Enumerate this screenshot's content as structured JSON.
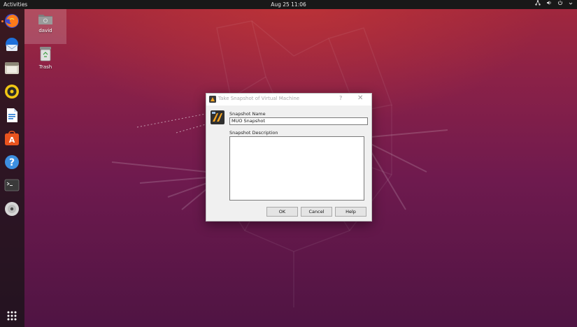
{
  "topbar": {
    "activities_label": "Activities",
    "clock": "Aug 25  11:06"
  },
  "desktop": {
    "icons": [
      {
        "label": "david",
        "icon": "home-folder-icon"
      },
      {
        "label": "Trash",
        "icon": "trash-icon"
      }
    ]
  },
  "dock": {
    "items": [
      "firefox-icon",
      "thunderbird-icon",
      "files-icon",
      "rhythmbox-icon",
      "libreoffice-writer-icon",
      "ubuntu-software-icon",
      "help-icon",
      "terminal-icon",
      "optical-disc-icon",
      "show-applications-icon"
    ]
  },
  "dialog": {
    "title": "Take Snapshot of Virtual Machine",
    "help_glyph": "?",
    "close_glyph": "✕",
    "snapshot_name_label": "Snapshot Name",
    "snapshot_name_value": "MUO Snapshot",
    "snapshot_description_label": "Snapshot Description",
    "snapshot_description_value": "",
    "ok_label": "OK",
    "cancel_label": "Cancel",
    "help_label": "Help"
  },
  "colors": {
    "topbar": "#181818",
    "dock_accent": "#ff7a2a",
    "wallpaper_top": "#a3283c",
    "wallpaper_bottom": "#4f1443"
  }
}
